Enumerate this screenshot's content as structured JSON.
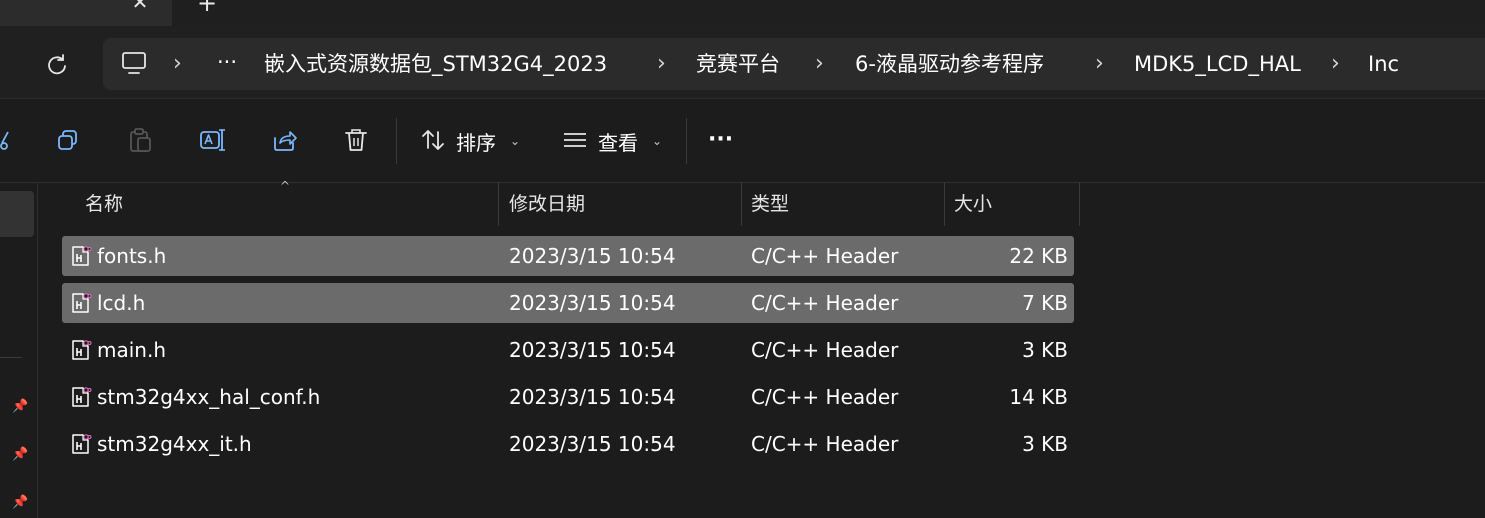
{
  "window": {
    "tab_close_glyph": "✕",
    "new_tab_glyph": "+"
  },
  "address": {
    "overflow_glyph": "···",
    "separator": "›",
    "crumbs": [
      "嵌入式资源数据包_STM32G4_2023",
      "竞赛平台",
      "6-液晶驱动参考程序",
      "MDK5_LCD_HAL",
      "Inc"
    ]
  },
  "toolbar": {
    "sort_label": "排序",
    "view_label": "查看",
    "more_glyph": "···",
    "icons": [
      "cut-icon",
      "copy-icon",
      "paste-icon",
      "rename-icon",
      "share-icon",
      "delete-icon"
    ]
  },
  "columns": {
    "name": "名称",
    "modified": "修改日期",
    "type": "类型",
    "size": "大小"
  },
  "files": [
    {
      "name": "fonts.h",
      "modified": "2023/3/15 10:54",
      "type": "C/C++ Header",
      "size": "22 KB",
      "selected": true
    },
    {
      "name": "lcd.h",
      "modified": "2023/3/15 10:54",
      "type": "C/C++ Header",
      "size": "7 KB",
      "selected": true
    },
    {
      "name": "main.h",
      "modified": "2023/3/15 10:54",
      "type": "C/C++ Header",
      "size": "3 KB",
      "selected": false
    },
    {
      "name": "stm32g4xx_hal_conf.h",
      "modified": "2023/3/15 10:54",
      "type": "C/C++ Header",
      "size": "14 KB",
      "selected": false
    },
    {
      "name": "stm32g4xx_it.h",
      "modified": "2023/3/15 10:54",
      "type": "C/C++ Header",
      "size": "3 KB",
      "selected": false
    }
  ],
  "colors": {
    "background": "#1c1c1c",
    "selected_row": "#6b6b6b",
    "address_bar": "#2b2b2b"
  }
}
